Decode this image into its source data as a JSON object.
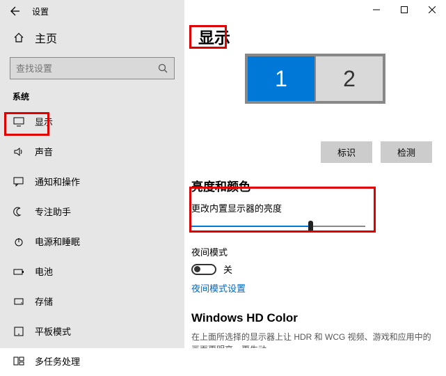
{
  "header": {
    "title": "设置"
  },
  "home_label": "主页",
  "search": {
    "placeholder": "查找设置"
  },
  "category": "系统",
  "nav": [
    {
      "label": "显示"
    },
    {
      "label": "声音"
    },
    {
      "label": "通知和操作"
    },
    {
      "label": "专注助手"
    },
    {
      "label": "电源和睡眠"
    },
    {
      "label": "电池"
    },
    {
      "label": "存储"
    },
    {
      "label": "平板模式"
    },
    {
      "label": "多任务处理"
    }
  ],
  "page_title": "显示",
  "monitors": {
    "m1": "1",
    "m2": "2",
    "identify": "标识",
    "detect": "检测"
  },
  "brightness": {
    "section": "亮度和颜色",
    "label": "更改内置显示器的亮度",
    "night_label": "夜间模式",
    "toggle_state": "关",
    "settings_link": "夜间模式设置"
  },
  "hd": {
    "title": "Windows HD Color",
    "desc": "在上面所选择的显示器上让 HDR 和 WCG 视频、游戏和应用中的画面更明亮、更生动。"
  }
}
